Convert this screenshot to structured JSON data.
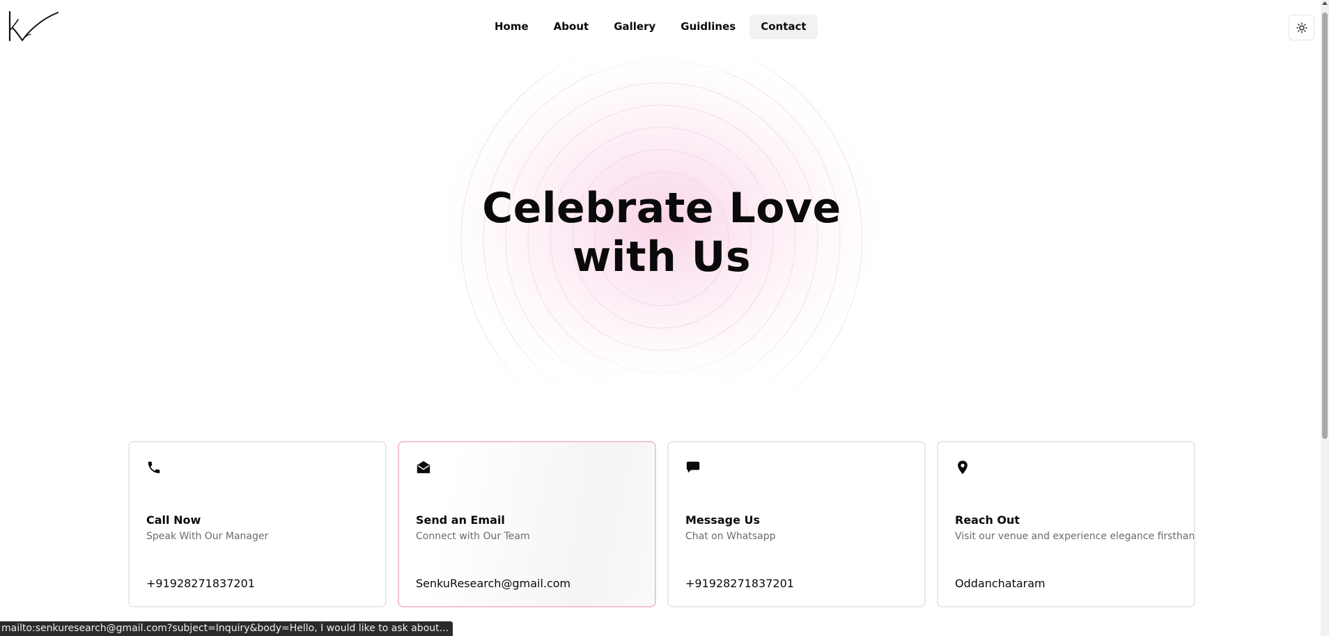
{
  "header": {
    "logo_icon": "signature-checkmark-logo",
    "nav": [
      {
        "label": "Home",
        "active": false
      },
      {
        "label": "About",
        "active": false
      },
      {
        "label": "Gallery",
        "active": false
      },
      {
        "label": "Guidlines",
        "active": false
      },
      {
        "label": "Contact",
        "active": true
      }
    ],
    "theme_toggle_icon": "sun-icon"
  },
  "hero": {
    "title": "Celebrate Love with Us",
    "glow_color": "#f7c6e0"
  },
  "cards": [
    {
      "icon": "phone-icon",
      "title": "Call Now",
      "subtitle": "Speak With Our Manager",
      "value": "+91928271837201"
    },
    {
      "icon": "envelope-open-icon",
      "title": "Send an Email",
      "subtitle": "Connect with Our Team",
      "value": "SenkuResearch@gmail.com"
    },
    {
      "icon": "chat-bubble-icon",
      "title": "Message Us",
      "subtitle": "Chat on Whatsapp",
      "value": "+91928271837201"
    },
    {
      "icon": "map-pin-icon",
      "title": "Reach Out",
      "subtitle": "Visit our venue and experience elegance firsthand!",
      "value": "Oddanchataram"
    }
  ],
  "status_bar": {
    "text": "mailto:senkuresearch@gmail.com?subject=Inquiry&body=Hello, I would like to ask about..."
  },
  "colors": {
    "accent_pink": "#f3c2dc",
    "text_primary": "#0a0a0a",
    "text_muted": "#6b6b6b"
  }
}
